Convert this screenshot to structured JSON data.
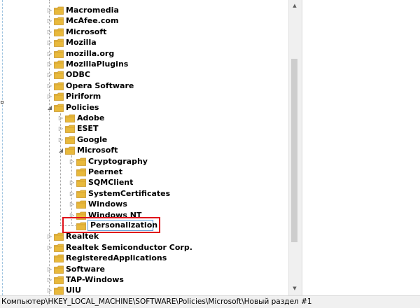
{
  "tree": {
    "items": [
      {
        "label": "Macromedia",
        "state": "collapsed"
      },
      {
        "label": "McAfee.com",
        "state": "collapsed"
      },
      {
        "label": "Microsoft",
        "state": "collapsed"
      },
      {
        "label": "Mozilla",
        "state": "collapsed"
      },
      {
        "label": "mozilla.org",
        "state": "collapsed"
      },
      {
        "label": "MozillaPlugins",
        "state": "collapsed"
      },
      {
        "label": "ODBC",
        "state": "collapsed"
      },
      {
        "label": "Opera Software",
        "state": "collapsed"
      },
      {
        "label": "Piriform",
        "state": "collapsed"
      },
      {
        "label": "Policies",
        "state": "expanded"
      },
      {
        "label": "Adobe",
        "state": "collapsed"
      },
      {
        "label": "ESET",
        "state": "collapsed"
      },
      {
        "label": "Google",
        "state": "collapsed"
      },
      {
        "label": "Microsoft",
        "state": "expanded"
      },
      {
        "label": "Cryptography",
        "state": "collapsed"
      },
      {
        "label": "Peernet",
        "state": "leaf"
      },
      {
        "label": "SQMClient",
        "state": "collapsed"
      },
      {
        "label": "SystemCertificates",
        "state": "collapsed"
      },
      {
        "label": "Windows",
        "state": "collapsed"
      },
      {
        "label": "Windows NT",
        "state": "collapsed"
      },
      {
        "label": "Personalization",
        "state": "editing"
      },
      {
        "label": "Realtek",
        "state": "collapsed"
      },
      {
        "label": "Realtek Semiconductor Corp.",
        "state": "collapsed"
      },
      {
        "label": "RegisteredApplications",
        "state": "leaf"
      },
      {
        "label": "Software",
        "state": "collapsed"
      },
      {
        "label": "TAP-Windows",
        "state": "collapsed"
      },
      {
        "label": "UIU",
        "state": "collapsed"
      }
    ]
  },
  "status_bar": {
    "path": "Компьютер\\HKEY_LOCAL_MACHINE\\SOFTWARE\\Policies\\Microsoft\\Новый раздел #1"
  },
  "colors": {
    "folder": "#e8b93c",
    "folder_dark": "#c9962a",
    "highlight": "#e0101a",
    "edit_border": "#5b9bd5"
  },
  "icons": {
    "collapsed": "▷",
    "expanded": "◢",
    "folder": "folder-icon"
  }
}
